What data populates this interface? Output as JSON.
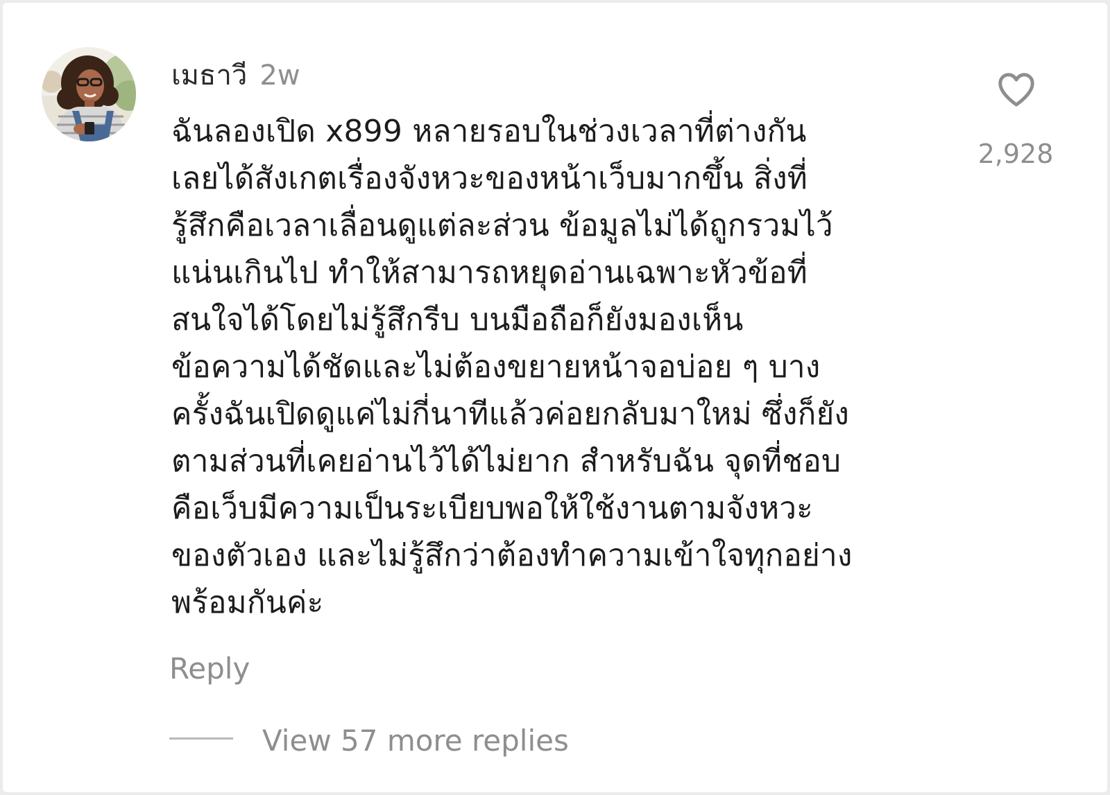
{
  "comment": {
    "username": "เมธาวี",
    "timestamp": "2w",
    "avatar_icon": "user-avatar-photo",
    "text_lines": [
      "ฉันลองเปิด x899 หลายรอบในช่วงเวลาที่ต่างกัน",
      "เลยได้สังเกตเรื่องจังหวะของหน้าเว็บมากขึ้น สิ่งที่",
      "รู้สึกคือเวลาเลื่อนดูแต่ละส่วน ข้อมูลไม่ได้ถูกรวมไว้",
      "แน่นเกินไป ทำให้สามารถหยุดอ่านเฉพาะหัวข้อที่",
      "สนใจได้โดยไม่รู้สึกรีบ บนมือถือก็ยังมองเห็น",
      "ข้อความได้ชัดและไม่ต้องขยายหน้าจอบ่อย ๆ บาง",
      "ครั้งฉันเปิดดูแค่ไม่กี่นาทีแล้วค่อยกลับมาใหม่ ซึ่งก็ยัง",
      "ตามส่วนที่เคยอ่านไว้ได้ไม่ยาก สำหรับฉัน จุดที่ชอบ",
      "คือเว็บมีความเป็นระเบียบพอให้ใช้งานตามจังหวะ",
      "ของตัวเอง และไม่รู้สึกว่าต้องทำความเข้าใจทุกอย่าง",
      "พร้อมกันค่ะ"
    ],
    "like_icon": "heart-outline-icon",
    "like_count": "2,928",
    "reply_label": "Reply",
    "view_replies_label": "View 57 more replies"
  },
  "colors": {
    "background": "#ffffff",
    "text_primary": "#1c1c1c",
    "text_secondary": "#8e8e8e",
    "divider": "#b8b8b8"
  }
}
